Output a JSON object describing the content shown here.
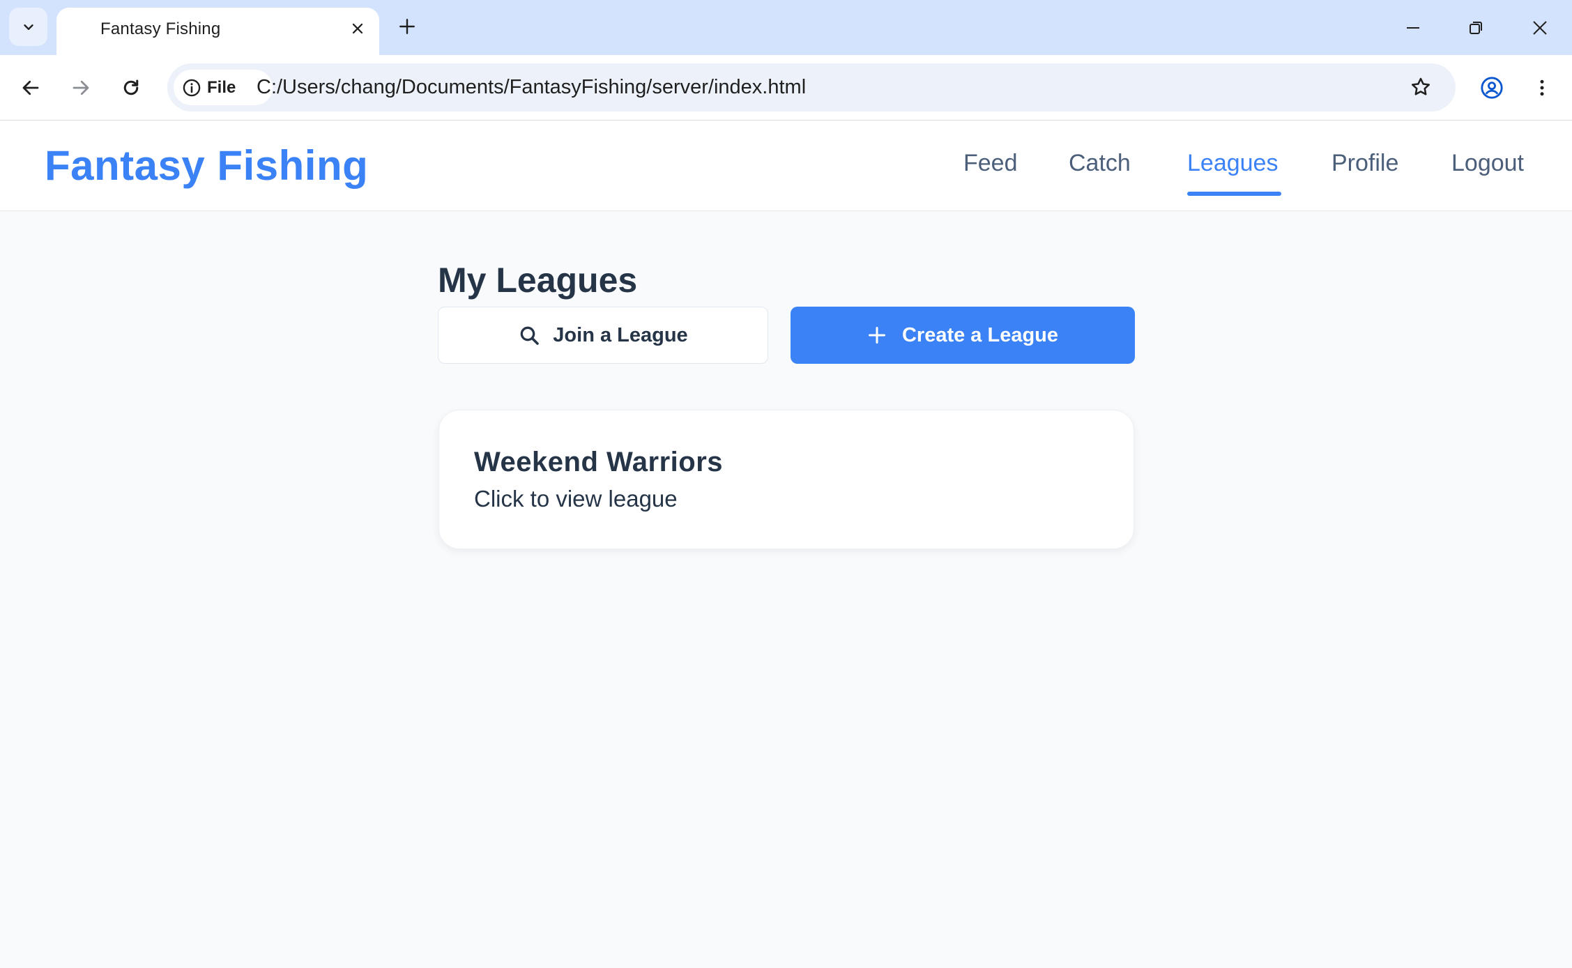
{
  "browser": {
    "tab_title": "Fantasy Fishing",
    "security_chip": "File",
    "url": "C:/Users/chang/Documents/FantasyFishing/server/index.html"
  },
  "app": {
    "brand": "Fantasy Fishing",
    "nav": [
      {
        "label": "Feed",
        "active": false
      },
      {
        "label": "Catch",
        "active": false
      },
      {
        "label": "Leagues",
        "active": true
      },
      {
        "label": "Profile",
        "active": false
      },
      {
        "label": "Logout",
        "active": false
      }
    ],
    "accent_color": "#3b82f6"
  },
  "main": {
    "title": "My Leagues",
    "join_button": "Join a League",
    "create_button": "Create a League",
    "leagues": [
      {
        "name": "Weekend Warriors",
        "subtitle": "Click to view league"
      }
    ]
  }
}
